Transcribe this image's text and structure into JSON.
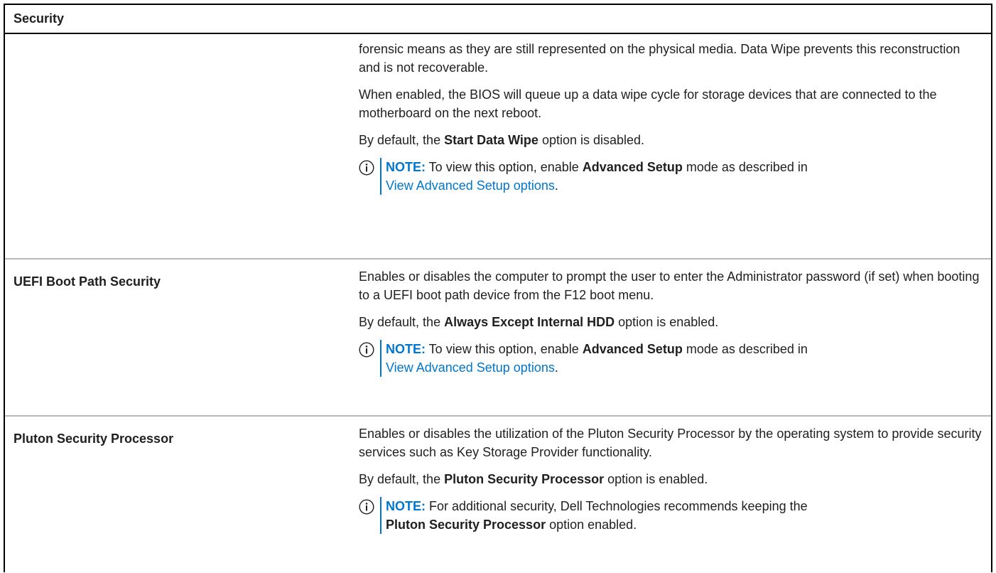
{
  "table": {
    "header": "Security",
    "rows": [
      {
        "name": "",
        "paragraphs": [
          {
            "text": "forensic means as they are still represented on the physical media. Data Wipe prevents this reconstruction and is not recoverable."
          },
          {
            "text": "When enabled, the BIOS will queue up a data wipe cycle for storage devices that are connected to the motherboard on the next reboot."
          }
        ],
        "default_prefix": "By default, the ",
        "default_bold": "Start Data Wipe",
        "default_suffix": " option is disabled.",
        "note": {
          "label": "NOTE:",
          "text_before": " To view this option, enable ",
          "bold": "Advanced Setup",
          "text_after": " mode as described in ",
          "link": "View Advanced Setup options",
          "end": "."
        }
      },
      {
        "name": "UEFI Boot Path Security",
        "paragraphs": [
          {
            "text": "Enables or disables the computer to prompt the user to enter the Administrator password (if set) when booting to a UEFI boot path device from the F12 boot menu."
          }
        ],
        "default_prefix": "By default, the ",
        "default_bold": "Always Except Internal HDD",
        "default_suffix": " option is enabled.",
        "note": {
          "label": "NOTE:",
          "text_before": " To view this option, enable ",
          "bold": "Advanced Setup",
          "text_after": " mode as described in ",
          "link": "View Advanced Setup options",
          "end": "."
        }
      },
      {
        "name": "Pluton Security Processor",
        "paragraphs": [
          {
            "text": "Enables or disables the utilization of the Pluton Security Processor by the operating system to provide security services such as Key Storage Provider functionality."
          }
        ],
        "default_prefix": "By default, the ",
        "default_bold": "Pluton Security Processor",
        "default_suffix": " option is enabled.",
        "note": {
          "label": "NOTE:",
          "text_before": " For additional security, Dell Technologies recommends keeping the ",
          "bold": "Pluton Security Processor",
          "text_after": " option enabled.",
          "link": "",
          "end": ""
        }
      }
    ]
  },
  "colors": {
    "accent": "#0076ce",
    "text": "#1f1f1f",
    "row_divider": "#b9b9b9",
    "border": "#000000"
  },
  "icons": {
    "note": "info-circle-icon"
  }
}
